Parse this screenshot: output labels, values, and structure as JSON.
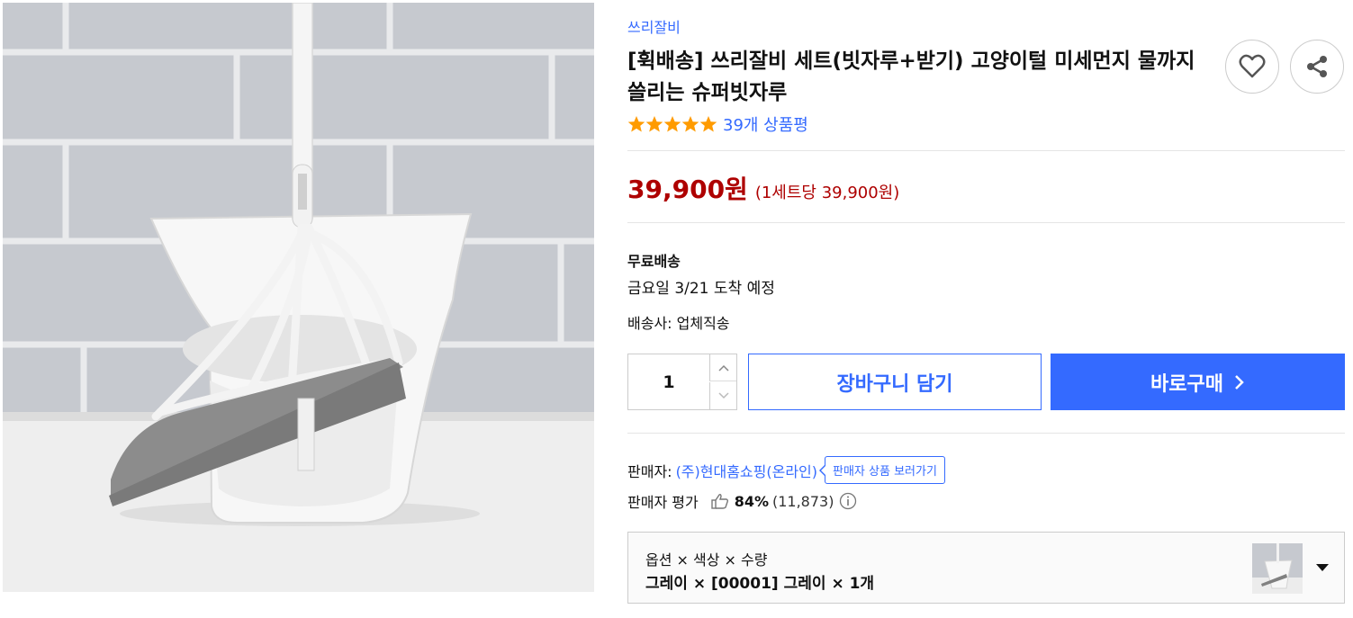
{
  "brand": {
    "name": "쓰리잘비"
  },
  "product": {
    "title": "[휙배송] 쓰리잘비 세트(빗자루+받기) 고양이털 미세먼지 물까지 쓸리는 슈퍼빗자루",
    "rating_stars": 5,
    "review_text": "39개 상품평"
  },
  "actions": {
    "wishlist_icon": "heart-icon",
    "share_icon": "share-icon"
  },
  "price": {
    "total": "39,900원",
    "unit": "(1세트당 39,900원)",
    "color": "#ae0000"
  },
  "shipping": {
    "type": "무료배송",
    "arrival": "금요일 3/21 도착 예정",
    "carrier": "배송사: 업체직송"
  },
  "purchase": {
    "quantity": "1",
    "cart_label": "장바구니 담기",
    "buy_label": "바로구매",
    "accent": "#346aff"
  },
  "seller": {
    "label": "판매자:",
    "name": "(주)현대홈쇼핑(온라인)",
    "shop_button": "판매자 상품 보러가기",
    "rating_label": "판매자 평가",
    "rating_pct": "84%",
    "rating_count": "(11,873)"
  },
  "options": {
    "labels": "옵션 × 색상 × 수량",
    "values": "그레이 × [00001] 그레이 × 1개"
  }
}
